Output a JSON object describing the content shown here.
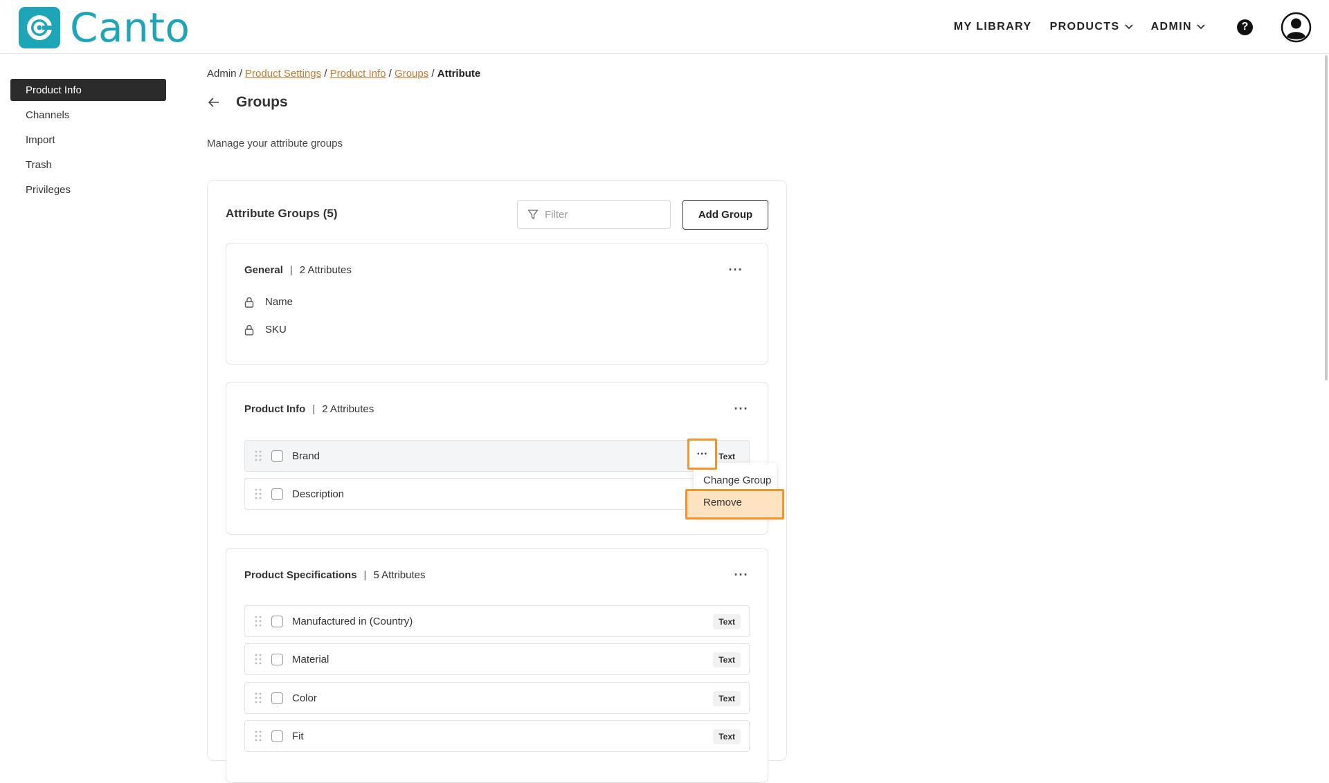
{
  "app": {
    "logo_text": "Canto"
  },
  "topnav": {
    "my_library": "MY LIBRARY",
    "products": "PRODUCTS",
    "admin": "ADMIN",
    "help": "?"
  },
  "sidebar": {
    "items": [
      {
        "label": "Product Info",
        "active": true
      },
      {
        "label": "Channels"
      },
      {
        "label": "Import"
      },
      {
        "label": "Trash"
      },
      {
        "label": "Privileges"
      }
    ]
  },
  "breadcrumb": {
    "admin": "Admin",
    "sep": " / ",
    "product_settings": "Product Settings",
    "product_info": "Product Info",
    "groups": "Groups",
    "current": "Attribute"
  },
  "page": {
    "title": "Groups",
    "subtitle": "Manage your attribute groups"
  },
  "panel": {
    "title": "Attribute Groups (5)",
    "filter_placeholder": "Filter",
    "add_group": "Add Group"
  },
  "groups": [
    {
      "name": "General",
      "count": "2 Attributes",
      "locked_items": [
        "Name",
        "SKU"
      ]
    },
    {
      "name": "Product Info",
      "count": "2 Attributes",
      "attributes": [
        {
          "label": "Brand",
          "type": "Text"
        },
        {
          "label": "Description"
        }
      ]
    },
    {
      "name": "Product Specifications",
      "count": "5 Attributes",
      "attributes": [
        {
          "label": "Manufactured in (Country)",
          "type": "Text"
        },
        {
          "label": "Material",
          "type": "Text"
        },
        {
          "label": "Color",
          "type": "Text"
        },
        {
          "label": "Fit",
          "type": "Text"
        }
      ]
    }
  ],
  "context_menu": {
    "change_group": "Change Group",
    "remove": "Remove"
  },
  "kebab": "···",
  "colors": {
    "brand": "#1fa5b8",
    "link": "#c8792d",
    "highlight_border": "#f0952a",
    "highlight_fill": "#fde3bf",
    "sidebar_active": "#2b2b2b"
  }
}
